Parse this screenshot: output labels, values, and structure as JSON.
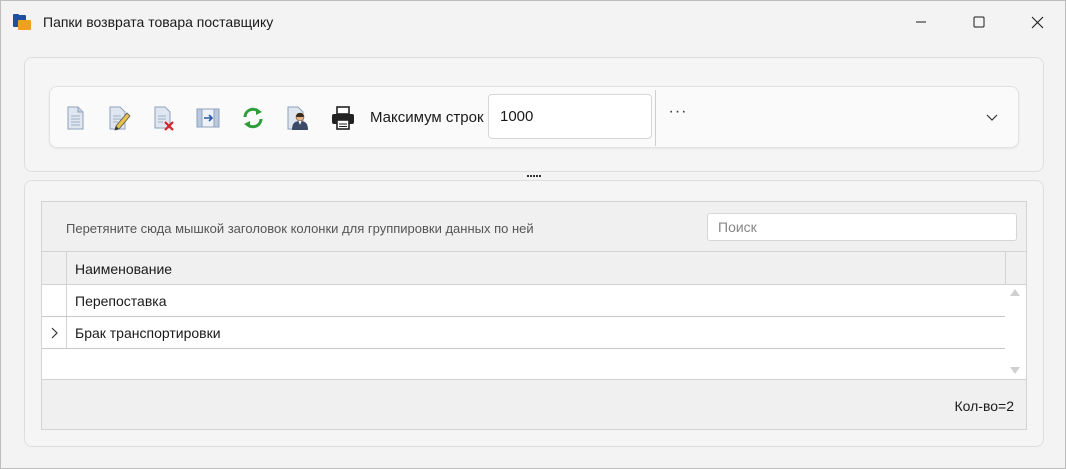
{
  "window": {
    "title": "Папки возврата товара поставщику",
    "icon": "folder-icon",
    "controls": [
      "minimize-icon",
      "maximize-icon",
      "close-icon"
    ]
  },
  "toolbar": {
    "buttons": [
      {
        "icon": "new-document-icon"
      },
      {
        "icon": "edit-document-icon"
      },
      {
        "icon": "delete-document-icon"
      },
      {
        "icon": "columns-icon"
      },
      {
        "icon": "refresh-icon"
      },
      {
        "icon": "user-document-icon"
      },
      {
        "icon": "print-icon"
      }
    ],
    "max_rows_label": "Максимум строк",
    "max_rows_value": "1000",
    "more": "···",
    "expand_icon": "chevron-down-icon"
  },
  "grid": {
    "group_hint": "Перетяните сюда мышкой заголовок колонки для группировки данных по ней",
    "search_placeholder": "Поиск",
    "search_value": "",
    "columns": [
      "Наименование"
    ],
    "rows": [
      {
        "name": "Перепоставка",
        "expandable": false
      },
      {
        "name": "Брак транспортировки",
        "expandable": true
      }
    ],
    "count": "Кол-во=2"
  },
  "colors": {
    "accent_refresh": "#2e9e3a",
    "window_bg": "#f3f3f3",
    "folder_blue": "#1e4fa0",
    "folder_orange": "#f0a020"
  }
}
